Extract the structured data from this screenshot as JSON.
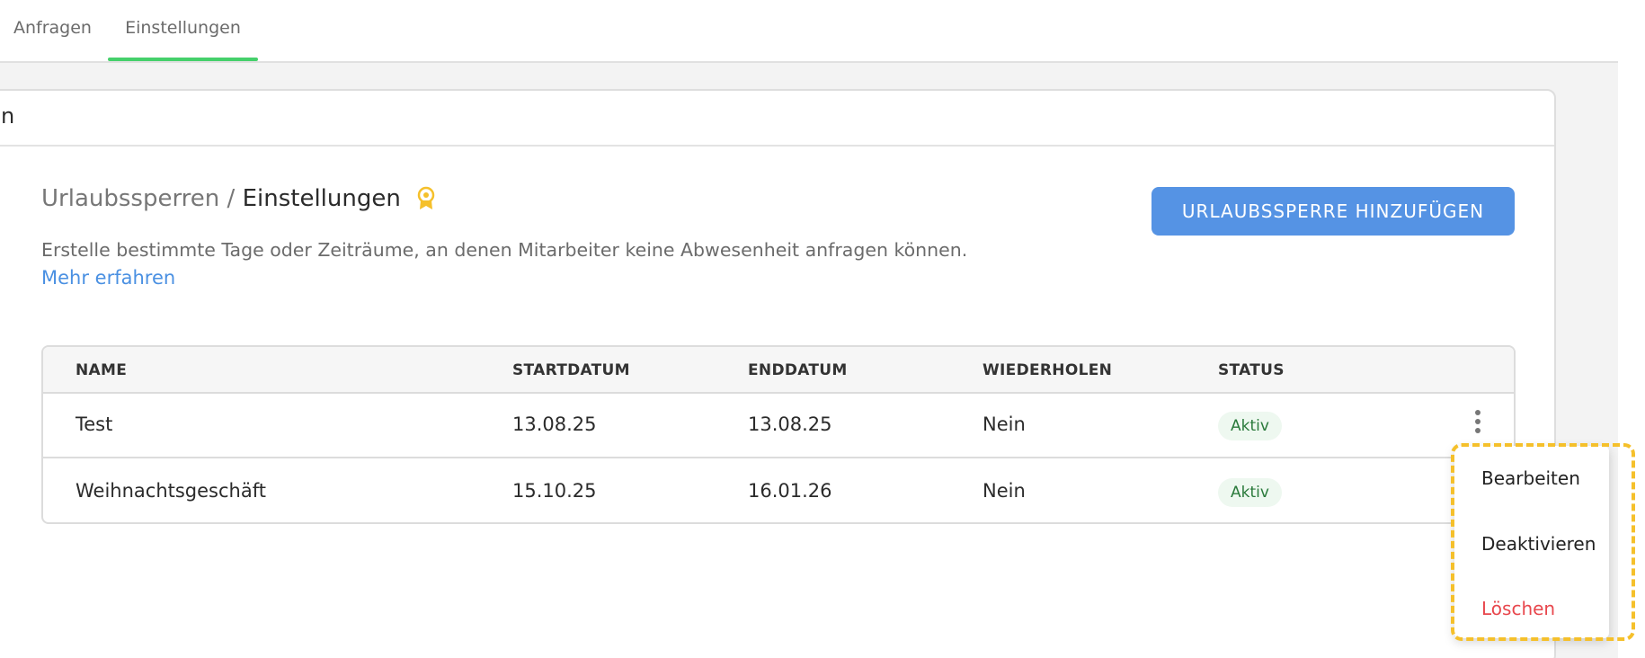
{
  "tabs": [
    {
      "label": "Anfragen"
    },
    {
      "label": "Einstellungen",
      "active": true
    }
  ],
  "card": {
    "header_fragment": "n"
  },
  "section": {
    "breadcrumb_parent": "Urlaubssperren",
    "breadcrumb_separator": " / ",
    "breadcrumb_current": "Einstellungen",
    "badge_icon": "award-ribbon-icon",
    "description": "Erstelle bestimmte Tage oder Zeiträume, an denen Mitarbeiter keine Abwesenheit anfragen können.",
    "learn_more": "Mehr erfahren",
    "add_button": "URLAUBSSPERRE HINZUFÜGEN"
  },
  "table": {
    "columns": [
      "NAME",
      "STARTDATUM",
      "ENDDATUM",
      "WIEDERHOLEN",
      "STATUS"
    ],
    "rows": [
      {
        "name": "Test",
        "start": "13.08.25",
        "end": "13.08.25",
        "repeat": "Nein",
        "status": "Aktiv"
      },
      {
        "name": "Weihnachtsgeschäft",
        "start": "15.10.25",
        "end": "16.01.26",
        "repeat": "Nein",
        "status": "Aktiv"
      }
    ]
  },
  "row_menu": {
    "items": [
      "Bearbeiten",
      "Deaktivieren",
      "Löschen"
    ]
  },
  "colors": {
    "accent_blue": "#5593e4",
    "active_tab_underline": "#45d06b",
    "status_green_text": "#2a7a3b",
    "danger_red": "#e8474d",
    "highlight_yellow": "#f5c02b"
  }
}
